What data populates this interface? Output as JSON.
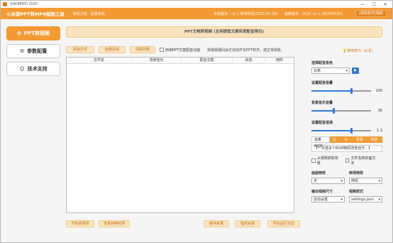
{
  "window": {
    "title": "XIAOMIPO 2025",
    "min": "—",
    "max": "☐",
    "close": "✕"
  },
  "header": {
    "app_title": "小米菠PPT转MP4视频工具",
    "slogan": "简单方便、批量高效",
    "local_version": "本机版本：v1.1  发布时间(2025-01-30)",
    "latest_version": "最新版本：2025 v1.1 (20250130)",
    "gen_button": "[获取软件]最新"
  },
  "sidebar": {
    "items": [
      {
        "label": "PPT转视频",
        "icon": "✿",
        "active": true
      },
      {
        "label": "参数配置",
        "icon": "⚙",
        "active": false
      },
      {
        "label": "技术支持",
        "icon": "☺",
        "active": false
      }
    ]
  },
  "main": {
    "banner": "PPT文档转视频 (支持提取文案实现配音旁白)",
    "toolbar": {
      "add_file": "添加文件",
      "batch_add": "批量添加",
      "clear_list": "清除列表",
      "chk_label": "启用PPT文案配音功能",
      "hint": "转视频期间会打自动开关PPT软件、建正常现象。"
    },
    "tips": "使用技巧（必看）",
    "table": {
      "columns": [
        "文件名",
        "背景音乐",
        "配音文案",
        "状态",
        "用时"
      ]
    },
    "bottom": {
      "start": "开始转视频",
      "view": "查看转换结果",
      "cache": "缓存目录",
      "temp": "临时目录",
      "log": "导出运行日志"
    }
  },
  "panel": {
    "voice_label": "选择配音角色",
    "voice_value": "云希",
    "volume_label": "设置配音音量",
    "volume_value": 100,
    "volume_frac": 0.67,
    "bgm_label": "背景音乐音量",
    "bgm_value": 38,
    "bgm_frac": 0.38,
    "speed_label": "设置配音语速",
    "speed_value": 1.3,
    "speed_frac": 0.67,
    "tabs": [
      "批量BGM",
      "片头",
      "片尾",
      "背景图",
      "背景色"
    ],
    "bgm_placeholder": "【一次选多个BGM随机背景音乐...】",
    "chk_extract": "从视频获取背景",
    "chk_filename": "文件名转封面文本",
    "effect_label": "画面特效",
    "effect_value": "无",
    "transition_label": "转场特效",
    "transition_value": "随机",
    "size_label": "输出视频尺寸",
    "size_value": "自动设置",
    "style_label": "视频样式",
    "style_value": "settings.json",
    "accent": "#f39a33",
    "slider_color": "#2f7bd8"
  }
}
